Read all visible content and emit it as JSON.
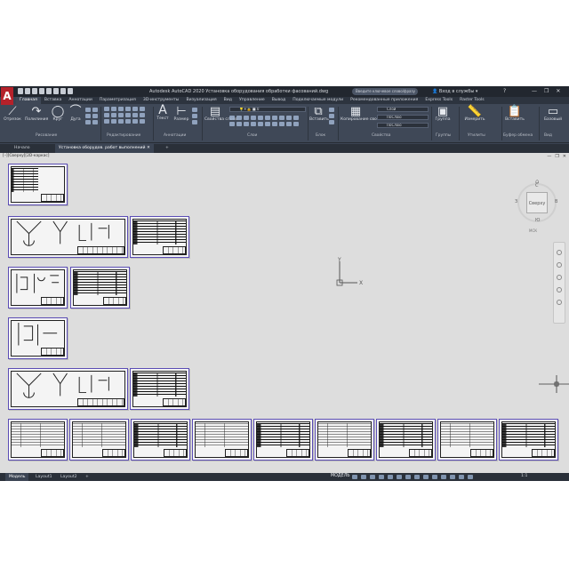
{
  "app": {
    "logo": "A",
    "title": "Autodesk AutoCAD 2020   Установка оборудования обработки фасований.dwg",
    "search_placeholder": "Введите ключевое слово/фразу",
    "user": "Вход в службы",
    "help": "?",
    "window_controls": [
      "—",
      "❐",
      "✕"
    ]
  },
  "ribbon_tabs": [
    "Главная",
    "Вставка",
    "Аннотации",
    "Параметризация",
    "3D-инструменты",
    "Визуализация",
    "Вид",
    "Управление",
    "Вывод",
    "Подключаемые модули",
    "Рекомендованные приложения",
    "Express Tools",
    "Raster Tools"
  ],
  "ribbon": {
    "draw_tools": [
      {
        "label": "Отрезок",
        "icon": "line-icon"
      },
      {
        "label": "Полилиния",
        "icon": "polyline-icon"
      },
      {
        "label": "Круг",
        "icon": "circle-icon"
      },
      {
        "label": "Дуга",
        "icon": "arc-icon"
      }
    ],
    "annotation_tools": [
      {
        "label": "Текст",
        "icon": "text-icon"
      },
      {
        "label": "Размер",
        "icon": "dimension-icon"
      }
    ],
    "layer_properties": "Свойства слоев",
    "insert_label": "Вставить",
    "match_properties": "Копирование свойств",
    "group_label": "Группа",
    "measure_label": "Измерить",
    "paste_label": "Вставить",
    "base_label": "Базовый",
    "properties": {
      "color": "Слой",
      "lineweight": "ПоСлою",
      "linetype": "ПоСлою"
    },
    "panels": [
      "Рисование",
      "Редактирование",
      "Аннотации",
      "Слои",
      "Блок",
      "Свойства",
      "Группы",
      "Утилиты",
      "Буфер обмена",
      "Вид"
    ]
  },
  "file_tabs": {
    "start": "Начало",
    "drawing": "Установка оборудов. работ выполнений",
    "close": "✕",
    "add": "+"
  },
  "canvas": {
    "view_label": "[–][Сверху][2D-каркас]",
    "window_mini": [
      "—",
      "❐",
      "✕"
    ],
    "viewcube": {
      "face": "Сверху",
      "north": "С",
      "south": "Ю",
      "west": "З",
      "east": "В",
      "wcs": "МСК"
    },
    "ucs": {
      "x": "X",
      "y": "Y"
    }
  },
  "layout_tabs": [
    "Модель",
    "Layout1",
    "Layout2",
    "+"
  ],
  "status": {
    "model": "МОДЕЛЬ",
    "scale": "1:1"
  }
}
